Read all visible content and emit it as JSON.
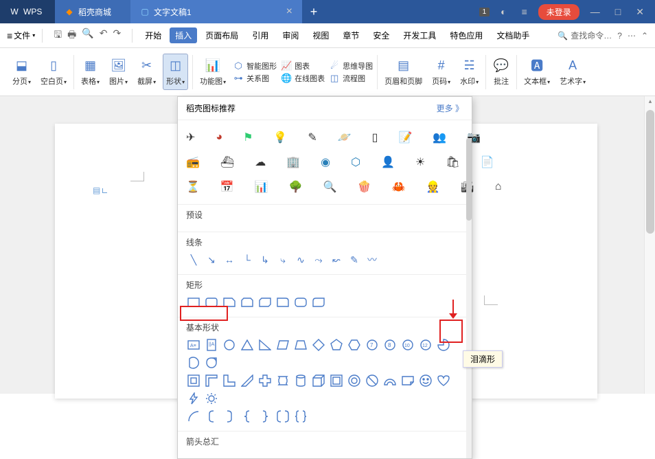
{
  "titlebar": {
    "wps": "WPS",
    "shop": "稻壳商城",
    "doc": "文字文稿1",
    "badge": "1",
    "login": "未登录"
  },
  "menu": {
    "file": "文件",
    "tabs": [
      "开始",
      "插入",
      "页面布局",
      "引用",
      "审阅",
      "视图",
      "章节",
      "安全",
      "开发工具",
      "特色应用",
      "文档助手"
    ],
    "search": "查找命令…"
  },
  "ribbon": {
    "page_break": "分页",
    "blank_page": "空白页",
    "table": "表格",
    "picture": "图片",
    "screenshot": "截屏",
    "shape": "形状",
    "func_chart": "功能图",
    "smart_art": "智能图形",
    "chart": "图表",
    "relation": "关系图",
    "mind": "思维导图",
    "online_chart": "在线图表",
    "flow": "流程图",
    "header_footer": "页眉和页脚",
    "page_num": "页码",
    "watermark": "水印",
    "comment": "批注",
    "textbox": "文本框",
    "wordart": "艺术字"
  },
  "dropdown": {
    "header": "稻壳图标推荐",
    "more": "更多 》",
    "presets": "预设",
    "lines": "线条",
    "rects": "矩形",
    "basic": "基本形状",
    "arrows": "箭头总汇"
  },
  "tooltip": "泪滴形"
}
